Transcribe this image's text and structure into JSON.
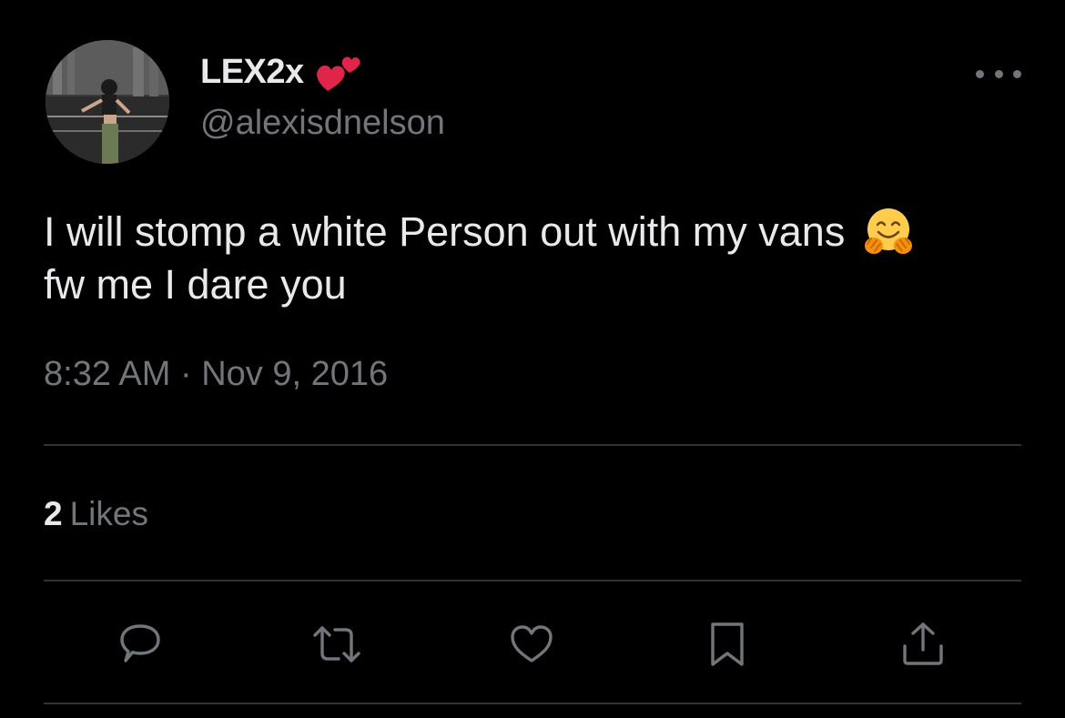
{
  "tweet": {
    "author": {
      "display_name": "LEX2x",
      "name_emoji": "two-hearts",
      "handle": "@alexisdnelson"
    },
    "text_line1": "I will stomp a white Person out with my vans",
    "text_emoji": "hugging-face",
    "text_line2": "fw me I dare you",
    "time": "8:32 AM",
    "separator": "·",
    "date": "Nov 9, 2016",
    "likes": {
      "count": "2",
      "label": "Likes"
    },
    "actions": [
      "reply-icon",
      "retweet-icon",
      "like-icon",
      "bookmark-icon",
      "share-icon"
    ]
  },
  "theme": {
    "background": "#000000",
    "primary_text": "#e7e9ea",
    "secondary_text": "#71767b",
    "divider": "#2f3336",
    "heart_red": "#e0254a"
  }
}
